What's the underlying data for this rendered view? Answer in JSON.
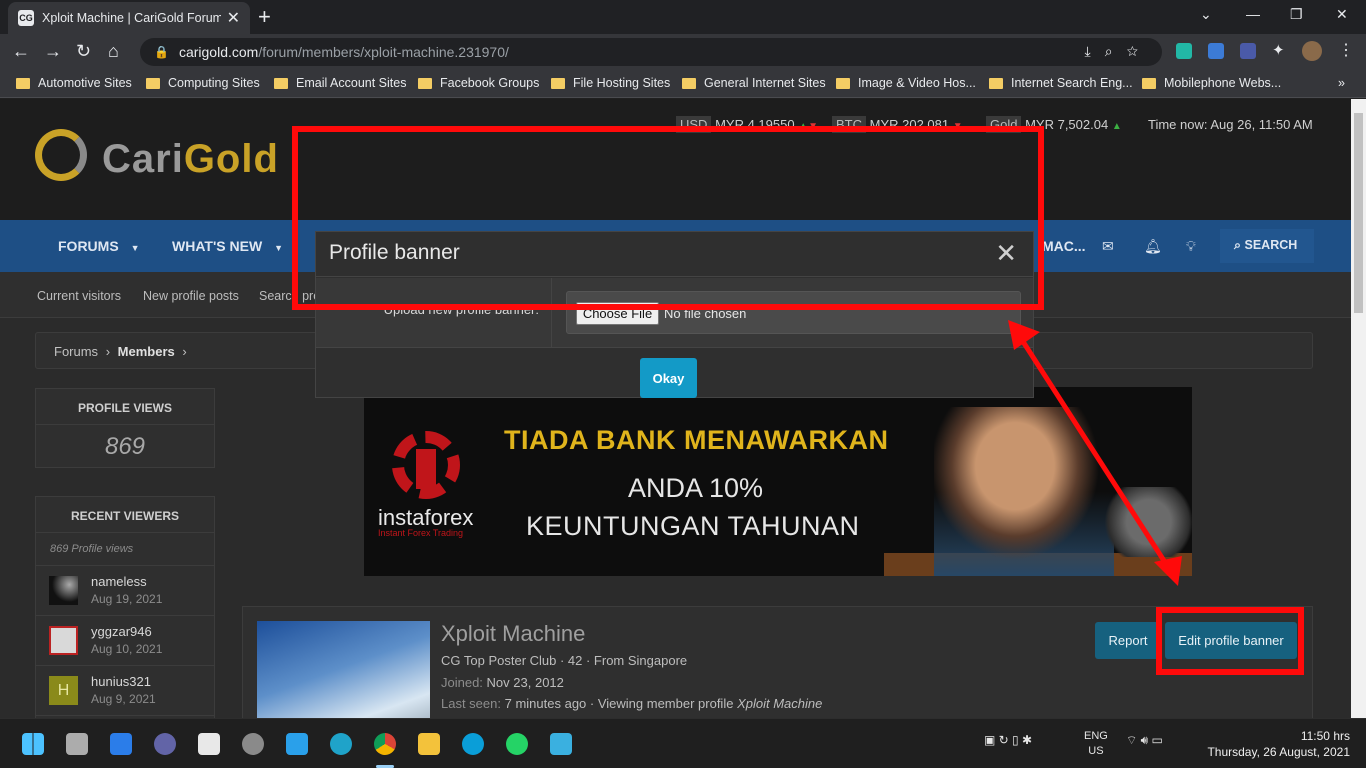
{
  "browser": {
    "tab_title": "Xploit Machine | CariGold Forum",
    "favicon_text": "CG",
    "url_host": "carigold.com",
    "url_path": "/forum/members/xploit-machine.231970/",
    "bookmarks": [
      "Automotive Sites",
      "Computing Sites",
      "Email Account Sites",
      "Facebook Groups",
      "File Hosting Sites",
      "General Internet Sites",
      "Image & Video Hos...",
      "Internet Search Eng...",
      "Mobilephone Webs..."
    ]
  },
  "site": {
    "logo_part1": "Cari",
    "logo_part2": "Gold",
    "ticker": {
      "usd_label": "USD",
      "usd_value": "MYR 4.19550",
      "btc_label": "BTC",
      "btc_value": "MYR 202,081",
      "gold_label": "Gold",
      "gold_value": "MYR 7,502.04",
      "time": "Time now: Aug 26, 11:50 AM"
    },
    "nav": {
      "forums": "FORUMS",
      "whats_new": "WHAT'S NEW",
      "user_short": "MAC...",
      "search": "SEARCH"
    },
    "subnav": {
      "current_visitors": "Current visitors",
      "new_profile_posts": "New profile posts",
      "search_profile_posts": "Search pro"
    },
    "breadcrumb": {
      "forums": "Forums",
      "members": "Members"
    }
  },
  "sidebar": {
    "profile_views_title": "PROFILE VIEWS",
    "profile_views_count": "869",
    "recent_viewers_title": "RECENT VIEWERS",
    "recent_viewers_sub": "869 Profile views",
    "viewers": [
      {
        "name": "nameless",
        "date": "Aug 19, 2021"
      },
      {
        "name": "yggzar946",
        "date": "Aug 10, 2021"
      },
      {
        "name": "hunius321",
        "date": "Aug 9, 2021",
        "avatar_letter": "H"
      }
    ]
  },
  "ad": {
    "brand": "instaforex",
    "brand_sub": "Instant Forex Trading",
    "line1": "TIADA BANK MENAWARKAN",
    "line2": "ANDA 10%",
    "line3": "KEUNTUNGAN TAHUNAN"
  },
  "profile": {
    "name": "Xploit Machine",
    "meta": "CG Top Poster Club · 42 · From Singapore",
    "joined_label": "Joined:",
    "joined_value": "Nov 23, 2012",
    "last_seen_label": "Last seen:",
    "last_seen_value": "7 minutes ago · Viewing member profile",
    "last_seen_profile": "Xploit Machine",
    "report_label": "Report",
    "edit_banner_label": "Edit profile banner"
  },
  "modal": {
    "title": "Profile banner",
    "close_glyph": "✕",
    "upload_label": "Upload new profile banner:",
    "choose_file_label": "Choose File",
    "no_file_text": "No file chosen",
    "okay_label": "Okay"
  },
  "taskbar": {
    "lang_line1": "ENG",
    "lang_line2": "US",
    "time": "11:50 hrs",
    "date": "Thursday, 26 August, 2021"
  },
  "colors": {
    "annotation_red": "#ff0a0a",
    "nav_blue": "#1e4f85",
    "button_teal": "#16617f",
    "okay_blue": "#139ac7",
    "gold": "#c9a227"
  }
}
